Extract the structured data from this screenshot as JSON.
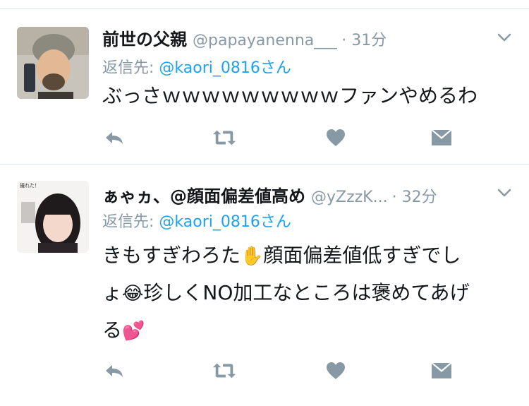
{
  "tweets": [
    {
      "display_name": "前世の父親",
      "handle": "@papayanenna___",
      "time": "· 31分",
      "reply_prefix": "返信先: ",
      "reply_mention": "@kaori_0816",
      "reply_suffix": "さん",
      "body_lines": [
        "ぶっさｗｗｗｗｗｗｗｗｗファンやめるわ"
      ]
    },
    {
      "display_name": "ぁゃヵ、@顔面偏差値高め",
      "handle": "@yZzzK...",
      "time": "· 32分",
      "reply_prefix": "返信先: ",
      "reply_mention": "@kaori_0816",
      "reply_suffix": "さん",
      "body_line1": "きもすぎわろた",
      "emoji_hand": "✋",
      "body_line1b": "顔面偏差値低すぎでし",
      "body_line2a": "ょ",
      "emoji_laugh": "😂",
      "body_line2b": "珍しくNO加工なところは褒めてあげ",
      "body_line3a": "る",
      "emoji_hearts": "💕",
      "avatar_caption": "撮れた！"
    }
  ],
  "icons": [
    "reply-icon",
    "retweet-icon",
    "like-icon",
    "message-icon",
    "chevron-down-icon"
  ],
  "colors": {
    "muted": "#8899a6",
    "link": "#1da1f2",
    "text": "#14171a",
    "divider": "#e1e8ed"
  }
}
